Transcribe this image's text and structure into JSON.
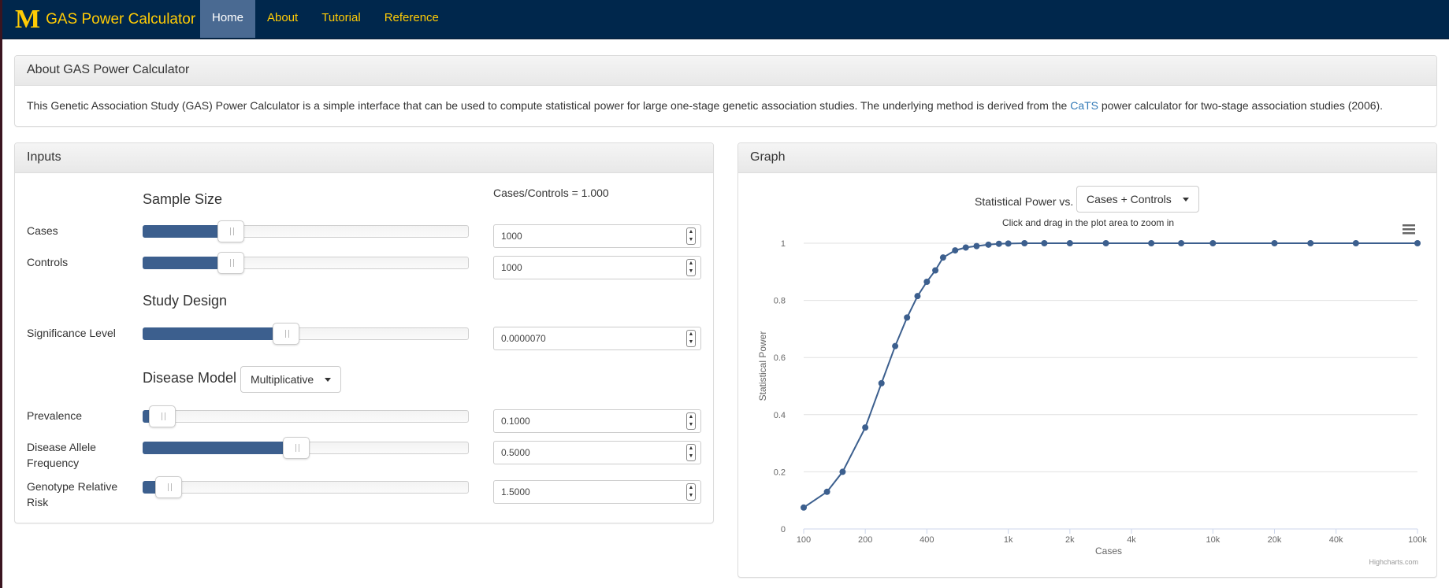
{
  "nav": {
    "logo": "M",
    "title": "GAS Power Calculator",
    "items": [
      {
        "label": "Home",
        "active": true
      },
      {
        "label": "About",
        "active": false
      },
      {
        "label": "Tutorial",
        "active": false
      },
      {
        "label": "Reference",
        "active": false
      }
    ]
  },
  "about": {
    "title": "About GAS Power Calculator",
    "text_before": "This Genetic Association Study (GAS) Power Calculator is a simple interface that can be used to compute statistical power for large one-stage genetic association studies. The underlying method is derived from the ",
    "link": "CaTS",
    "text_after": " power calculator for two-stage association studies (2006)."
  },
  "inputs": {
    "title": "Inputs",
    "sample_size_title": "Sample Size",
    "ratio_text": "Cases/Controls = 1.000",
    "study_design_title": "Study Design",
    "disease_model_title": "Disease Model",
    "disease_model_value": "Multiplicative",
    "fields": {
      "cases": {
        "label": "Cases",
        "value": "1000",
        "fraction": 0.27
      },
      "controls": {
        "label": "Controls",
        "value": "1000",
        "fraction": 0.27
      },
      "significance": {
        "label": "Significance Level",
        "value": "0.0000070",
        "fraction": 0.44
      },
      "prevalence": {
        "label": "Prevalence",
        "value": "0.1000",
        "fraction": 0.06
      },
      "allele_freq": {
        "label": "Disease Allele Frequency",
        "value": "0.5000",
        "fraction": 0.47
      },
      "grr": {
        "label": "Genotype Relative Risk",
        "value": "1.5000",
        "fraction": 0.08
      }
    }
  },
  "graph": {
    "title": "Graph",
    "selector_label": "Statistical Power vs.",
    "selector_value": "Cases + Controls",
    "zoom_hint": "Click and drag in the plot area to zoom in",
    "credits": "Highcharts.com",
    "menu_icon": "hamburger-menu-icon"
  },
  "chart_data": {
    "type": "line",
    "xlabel": "Cases",
    "ylabel": "Statistical Power",
    "xscale": "log",
    "xlim": [
      100,
      100000
    ],
    "ylim": [
      0,
      1
    ],
    "x_ticks": [
      100,
      200,
      400,
      1000,
      2000,
      4000,
      10000,
      20000,
      40000,
      100000
    ],
    "x_tick_labels": [
      "100",
      "200",
      "400",
      "1k",
      "2k",
      "4k",
      "10k",
      "20k",
      "40k",
      "100k"
    ],
    "y_ticks": [
      0,
      0.2,
      0.4,
      0.6,
      0.8,
      1
    ],
    "y_tick_labels": [
      "0",
      "0.2",
      "0.4",
      "0.6",
      "0.8",
      "1"
    ],
    "grid": true,
    "color": "#3c5f8e",
    "series": [
      {
        "x": [
          100,
          130,
          155,
          200,
          240,
          280,
          320,
          360,
          400,
          440,
          480,
          550,
          620,
          700,
          800,
          900,
          1000,
          1200,
          1500,
          2000,
          3000,
          5000,
          7000,
          10000,
          20000,
          30000,
          50000,
          100000
        ],
        "y": [
          0.075,
          0.13,
          0.2,
          0.355,
          0.51,
          0.64,
          0.74,
          0.815,
          0.865,
          0.905,
          0.95,
          0.975,
          0.985,
          0.99,
          0.995,
          0.998,
          0.999,
          1,
          1,
          1,
          1,
          1,
          1,
          1,
          1,
          1,
          1,
          1
        ]
      }
    ]
  }
}
